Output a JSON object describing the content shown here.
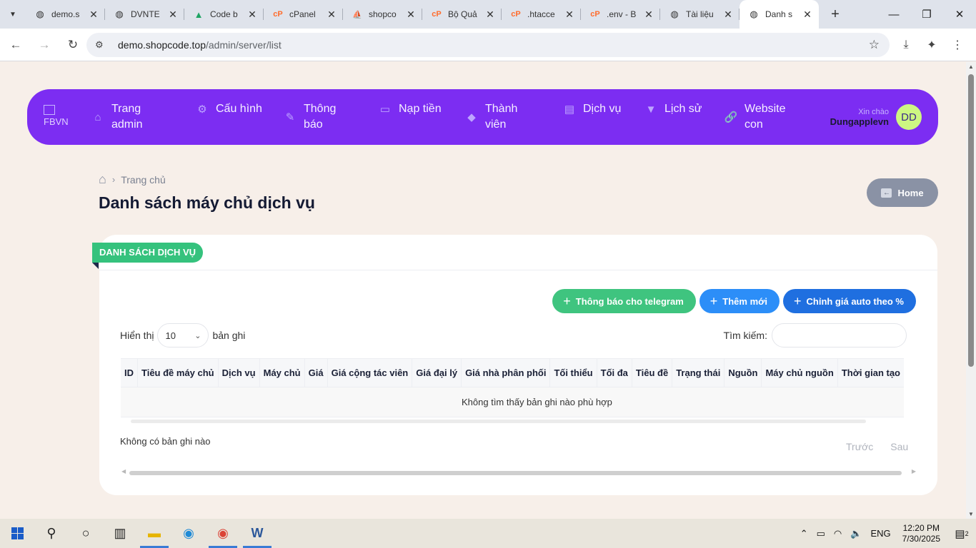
{
  "browser": {
    "tabs": [
      {
        "title": "demo.s",
        "favicon": "globe-icon"
      },
      {
        "title": "DVNTE",
        "favicon": "globe-icon"
      },
      {
        "title": "Code b",
        "favicon": "drive-icon"
      },
      {
        "title": "cPanel",
        "favicon": "cpanel-icon"
      },
      {
        "title": "shopco",
        "favicon": "pma-icon"
      },
      {
        "title": "Bộ Quả",
        "favicon": "cpanel-icon"
      },
      {
        "title": ".htacce",
        "favicon": "cpanel-icon"
      },
      {
        "title": ".env - B",
        "favicon": "cpanel-icon"
      },
      {
        "title": "Tài liệu",
        "favicon": "globe-icon"
      },
      {
        "title": "Danh s",
        "favicon": "globe-icon"
      }
    ],
    "url_host": "demo.shopcode.top",
    "url_path": "/admin/server/list"
  },
  "nav": {
    "brand": "FBVN",
    "items": [
      {
        "label": "Trang admin",
        "icon": "home-icon"
      },
      {
        "label": "Cấu hình",
        "icon": "gear-icon"
      },
      {
        "label": "Thông báo",
        "icon": "edit-icon"
      },
      {
        "label": "Nạp tiền",
        "icon": "card-icon"
      },
      {
        "label": "Thành viên",
        "icon": "gem-icon"
      },
      {
        "label": "Dịch vụ",
        "icon": "chart-icon"
      },
      {
        "label": "Lịch sử",
        "icon": "filter-icon"
      },
      {
        "label": "Website con",
        "icon": "link-icon"
      }
    ],
    "greeting": "Xin chào",
    "username": "Dungapplevn",
    "avatar_initials": "DD"
  },
  "breadcrumb": {
    "current": "Trang chủ"
  },
  "page_title": "Danh sách máy chủ dịch vụ",
  "home_button": "Home",
  "card": {
    "ribbon": "DANH SÁCH DỊCH VỤ",
    "actions": [
      {
        "label": "Thông báo cho telegram",
        "color": "#3fc47f"
      },
      {
        "label": "Thêm mới",
        "color": "#2c8ef8"
      },
      {
        "label": "Chỉnh giá auto theo %",
        "color": "#1f6fe0"
      }
    ],
    "show_prefix": "Hiển thị",
    "page_size": "10",
    "show_suffix": "bản ghi",
    "search_label": "Tìm kiếm:",
    "columns": [
      "ID",
      "Tiêu đề máy chủ",
      "Dịch vụ",
      "Máy chủ",
      "Giá",
      "Giá cộng tác viên",
      "Giá đại lý",
      "Giá nhà phân phối",
      "Tối thiểu",
      "Tối đa",
      "Tiêu đề",
      "Trạng thái",
      "Nguồn",
      "Máy chủ nguồn",
      "Thời gian tạo"
    ],
    "empty_message": "Không tìm thấy bản ghi nào phù hợp",
    "info": "Không có bản ghi nào",
    "prev": "Trước",
    "next": "Sau"
  },
  "taskbar": {
    "language": "ENG",
    "time": "12:20 PM",
    "date": "7/30/2025",
    "notifications": "2"
  }
}
